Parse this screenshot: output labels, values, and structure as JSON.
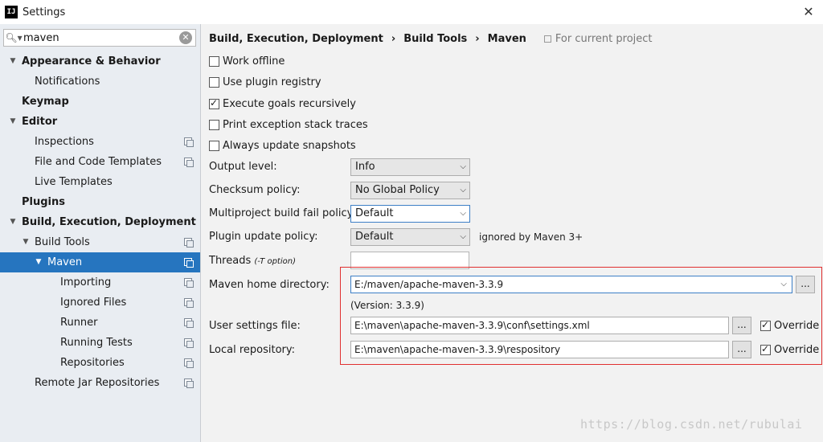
{
  "window": {
    "title": "Settings",
    "logo": "IJ"
  },
  "search": {
    "value": "maven"
  },
  "tree": [
    {
      "label": "Appearance & Behavior",
      "bold": true,
      "indent": 0,
      "arrow": "down"
    },
    {
      "label": "Notifications",
      "bold": false,
      "indent": 1
    },
    {
      "label": "Keymap",
      "bold": true,
      "indent": 0
    },
    {
      "label": "Editor",
      "bold": true,
      "indent": 0,
      "arrow": "down"
    },
    {
      "label": "Inspections",
      "bold": false,
      "indent": 1,
      "icon": true
    },
    {
      "label": "File and Code Templates",
      "bold": false,
      "indent": 1,
      "icon": true
    },
    {
      "label": "Live Templates",
      "bold": false,
      "indent": 1
    },
    {
      "label": "Plugins",
      "bold": true,
      "indent": 0
    },
    {
      "label": "Build, Execution, Deployment",
      "bold": true,
      "indent": 0,
      "arrow": "down"
    },
    {
      "label": "Build Tools",
      "bold": false,
      "indent": 1,
      "arrow": "down",
      "icon": true
    },
    {
      "label": "Maven",
      "bold": false,
      "indent": 2,
      "arrow": "down",
      "icon": true,
      "selected": true
    },
    {
      "label": "Importing",
      "bold": false,
      "indent": 3,
      "icon": true
    },
    {
      "label": "Ignored Files",
      "bold": false,
      "indent": 3,
      "icon": true
    },
    {
      "label": "Runner",
      "bold": false,
      "indent": 3,
      "icon": true
    },
    {
      "label": "Running Tests",
      "bold": false,
      "indent": 3,
      "icon": true
    },
    {
      "label": "Repositories",
      "bold": false,
      "indent": 3,
      "icon": true
    },
    {
      "label": "Remote Jar Repositories",
      "bold": false,
      "indent": 1,
      "icon": true
    }
  ],
  "breadcrumb": {
    "items": [
      "Build, Execution, Deployment",
      "Build Tools",
      "Maven"
    ],
    "separator": "›",
    "scope": "For current project"
  },
  "checkboxes": [
    {
      "label": "Work offline",
      "checked": false
    },
    {
      "label": "Use plugin registry",
      "checked": false
    },
    {
      "label": "Execute goals recursively",
      "checked": true
    },
    {
      "label": "Print exception stack traces",
      "checked": false
    },
    {
      "label": "Always update snapshots",
      "checked": false
    }
  ],
  "form": {
    "output_level": {
      "label": "Output level:",
      "value": "Info"
    },
    "checksum_policy": {
      "label": "Checksum policy:",
      "value": "No Global Policy"
    },
    "multiproject_fail": {
      "label": "Multiproject build fail policy:",
      "value": "Default"
    },
    "plugin_update": {
      "label": "Plugin update policy:",
      "value": "Default",
      "hint": "ignored by Maven 3+"
    },
    "threads": {
      "label": "Threads",
      "note": "(-T option)",
      "value": ""
    },
    "maven_home": {
      "label": "Maven home directory:",
      "value": "E:/maven/apache-maven-3.3.9",
      "version": "(Version: 3.3.9)"
    },
    "user_settings": {
      "label": "User settings file:",
      "value": "E:\\maven\\apache-maven-3.3.9\\conf\\settings.xml",
      "override_label": "Override",
      "override": true
    },
    "local_repo": {
      "label": "Local repository:",
      "value": "E:\\maven\\apache-maven-3.3.9\\respository",
      "override_label": "Override",
      "override": true
    },
    "browse_label": "...",
    "chevron": "⌵"
  },
  "watermark": "https://blog.csdn.net/rubulai",
  "colors": {
    "selection": "#2675bf",
    "highlight_box": "#e03030",
    "focus": "#3d7fc6"
  }
}
